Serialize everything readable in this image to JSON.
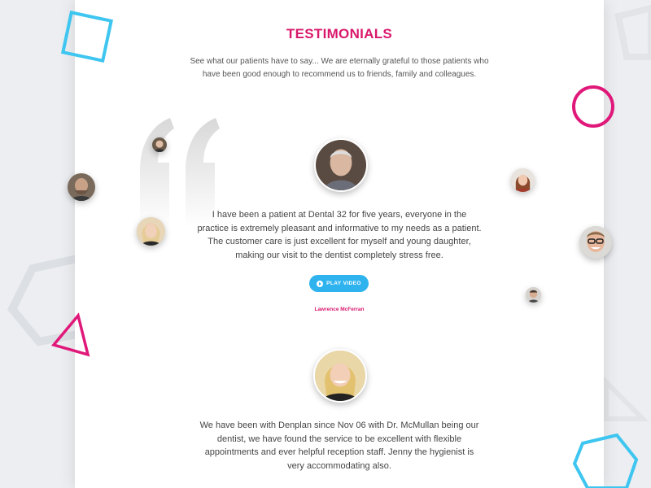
{
  "section": {
    "title": "TESTIMONIALS",
    "subtitle": "See what our patients have to say... We are eternally grateful to those patients who have been good enough to recommend us to friends, family and colleagues."
  },
  "testimonials": [
    {
      "text": "I have been a patient at Dental 32 for five years, everyone in the practice is extremely pleasant and informative to my needs as a patient. The customer care is just excellent for myself and young daughter, making our visit to the dentist completely stress free.",
      "button_label": "PLAY VIDEO",
      "author": "Lawrence McFerran"
    },
    {
      "text": "We have been with Denplan since Nov 06 with Dr. McMullan being our dentist, we have found the service to be excellent with flexible appointments and ever helpful reception staff. Jenny the hygienist is very accommodating also."
    }
  ],
  "colors": {
    "accent": "#d9186c",
    "button": "#2fb3ef",
    "shape_blue": "#3ec6f0",
    "shape_pink": "#e0187a"
  },
  "icons": [
    "quote-icon",
    "play-icon"
  ]
}
